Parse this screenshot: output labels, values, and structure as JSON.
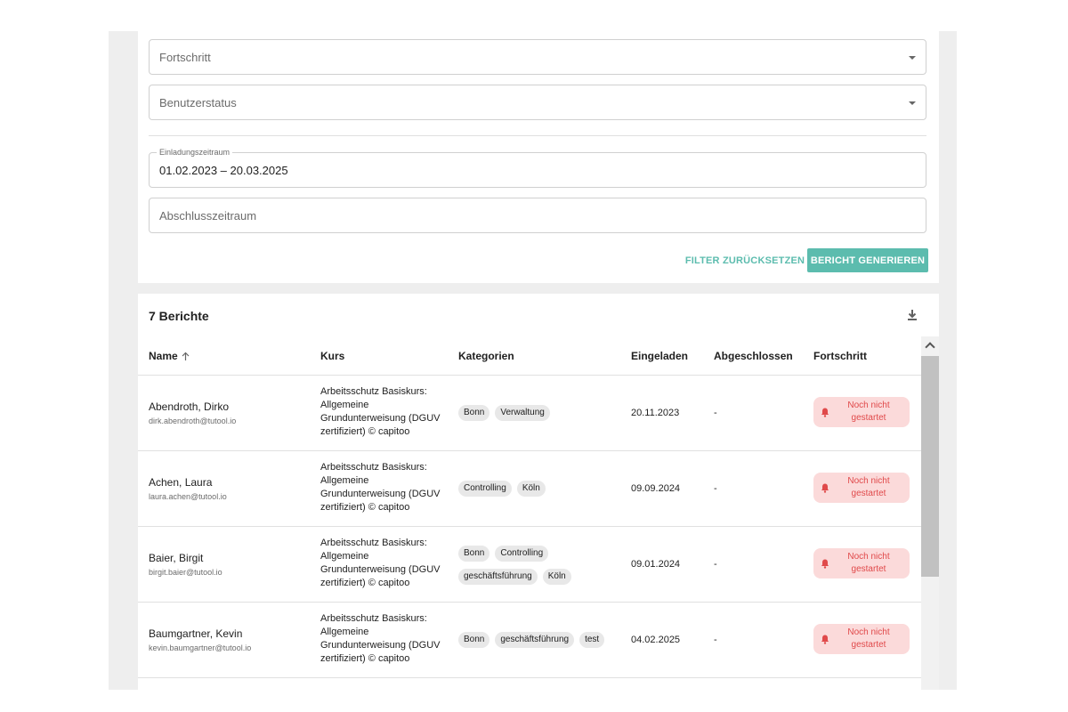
{
  "filters": {
    "fortschritt_placeholder": "Fortschritt",
    "benutzerstatus_placeholder": "Benutzerstatus",
    "einladung_label": "Einladungszeitraum",
    "einladung_value": "01.02.2023 – 20.03.2025",
    "abschluss_placeholder": "Abschlusszeitraum",
    "reset_label": "FILTER ZURÜCKSETZEN",
    "generate_label": "BERICHT GENERIEREN"
  },
  "report": {
    "title": "7 Berichte",
    "columns": {
      "name": "Name",
      "kurs": "Kurs",
      "kategorien": "Kategorien",
      "eingeladen": "Eingeladen",
      "abgeschlossen": "Abgeschlossen",
      "fortschritt": "Fortschritt"
    },
    "rows": [
      {
        "name": "Abendroth, Dirko",
        "email": "dirk.abendroth@tutool.io",
        "course": "Arbeitsschutz Basiskurs: Allgemeine Grundunterweisung (DGUV zertifiziert) © capitoo",
        "categories": [
          "Bonn",
          "Verwaltung"
        ],
        "invited": "20.11.2023",
        "completed": "-",
        "status": "Noch nicht gestartet"
      },
      {
        "name": "Achen, Laura",
        "email": "laura.achen@tutool.io",
        "course": "Arbeitsschutz Basiskurs: Allgemeine Grundunterweisung (DGUV zertifiziert) © capitoo",
        "categories": [
          "Controlling",
          "Köln"
        ],
        "invited": "09.09.2024",
        "completed": "-",
        "status": "Noch nicht gestartet"
      },
      {
        "name": "Baier, Birgit",
        "email": "birgit.baier@tutool.io",
        "course": "Arbeitsschutz Basiskurs: Allgemeine Grundunterweisung (DGUV zertifiziert) © capitoo",
        "categories": [
          "Bonn",
          "Controlling",
          "geschäftsführung",
          "Köln"
        ],
        "invited": "09.01.2024",
        "completed": "-",
        "status": "Noch nicht gestartet"
      },
      {
        "name": "Baumgartner, Kevin",
        "email": "kevin.baumgartner@tutool.io",
        "course": "Arbeitsschutz Basiskurs: Allgemeine Grundunterweisung (DGUV zertifiziert) © capitoo",
        "categories": [
          "Bonn",
          "geschäftsführung",
          "test"
        ],
        "invited": "04.02.2025",
        "completed": "-",
        "status": "Noch nicht gestartet"
      }
    ]
  },
  "colors": {
    "accent": "#5cbcae",
    "status_bg": "#fbdada",
    "status_text": "#e0494a"
  }
}
